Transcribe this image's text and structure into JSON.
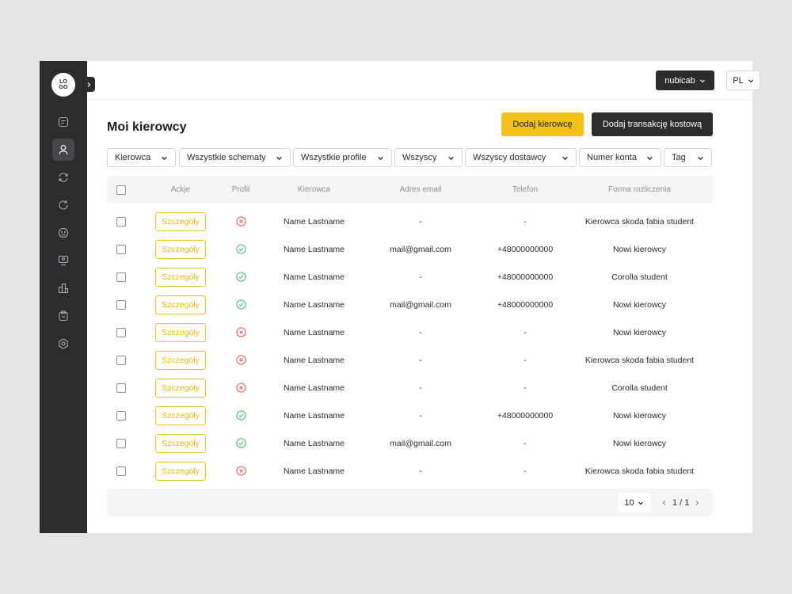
{
  "logo": {
    "text": "LO GO"
  },
  "sidebar": {
    "items": [
      {
        "name": "document-icon",
        "active": false
      },
      {
        "name": "user-icon",
        "active": true
      },
      {
        "name": "sync-icon",
        "active": false
      },
      {
        "name": "refresh-icon",
        "active": false
      },
      {
        "name": "face-icon",
        "active": false
      },
      {
        "name": "monitor-user-icon",
        "active": false
      },
      {
        "name": "buildings-icon",
        "active": false
      },
      {
        "name": "receipt-icon",
        "active": false
      },
      {
        "name": "settings-icon",
        "active": false
      }
    ]
  },
  "topbar": {
    "account": "nubicab",
    "language": "PL"
  },
  "page": {
    "title": "Moi kierowcy",
    "add_driver": "Dodaj kierowcę",
    "add_transaction": "Dodaj transakcję kostową"
  },
  "filters": [
    "Kierowca",
    "Wszystkie schematy",
    "Wszystkie profile",
    "Wszyscy",
    "Wszyscy dostawcy",
    "Numer konta",
    "Tag"
  ],
  "table": {
    "headers": {
      "actions": "Ackje",
      "profile": "Profil",
      "driver": "Kierowca",
      "email": "Adres email",
      "phone": "Telefon",
      "billing": "Forma rozliczenia"
    },
    "details_label": "Szczegóły",
    "rows": [
      {
        "profile_ok": false,
        "name": "Name Lastname",
        "email": "-",
        "phone": "-",
        "billing": "Kierowca skoda fabia student"
      },
      {
        "profile_ok": true,
        "name": "Name Lastname",
        "email": "mail@gmail.com",
        "phone": "+48000000000",
        "billing": "Nowi kierowcy"
      },
      {
        "profile_ok": true,
        "name": "Name Lastname",
        "email": "-",
        "phone": "+48000000000",
        "billing": "Corolla student"
      },
      {
        "profile_ok": true,
        "name": "Name Lastname",
        "email": "mail@gmail.com",
        "phone": "+48000000000",
        "billing": "Nowi kierowcy"
      },
      {
        "profile_ok": false,
        "name": "Name Lastname",
        "email": "-",
        "phone": "-",
        "billing": "Nowi kierowcy"
      },
      {
        "profile_ok": false,
        "name": "Name Lastname",
        "email": "-",
        "phone": "-",
        "billing": "Kierowca skoda fabia student"
      },
      {
        "profile_ok": false,
        "name": "Name Lastname",
        "email": "-",
        "phone": "-",
        "billing": "Corolla student"
      },
      {
        "profile_ok": true,
        "name": "Name Lastname",
        "email": "-",
        "phone": "+48000000000",
        "billing": "Nowi kierowcy"
      },
      {
        "profile_ok": true,
        "name": "Name Lastname",
        "email": "mail@gmail.com",
        "phone": "-",
        "billing": "Nowi kierowcy"
      },
      {
        "profile_ok": false,
        "name": "Name Lastname",
        "email": "-",
        "phone": "-",
        "billing": "Kierowca skoda fabia student"
      }
    ]
  },
  "pagination": {
    "page_size": "10",
    "page_info": "1 / 1"
  },
  "colors": {
    "accent": "#f2c21b",
    "dark": "#2b2c2e",
    "ok": "#35b35a",
    "error": "#e04848"
  }
}
